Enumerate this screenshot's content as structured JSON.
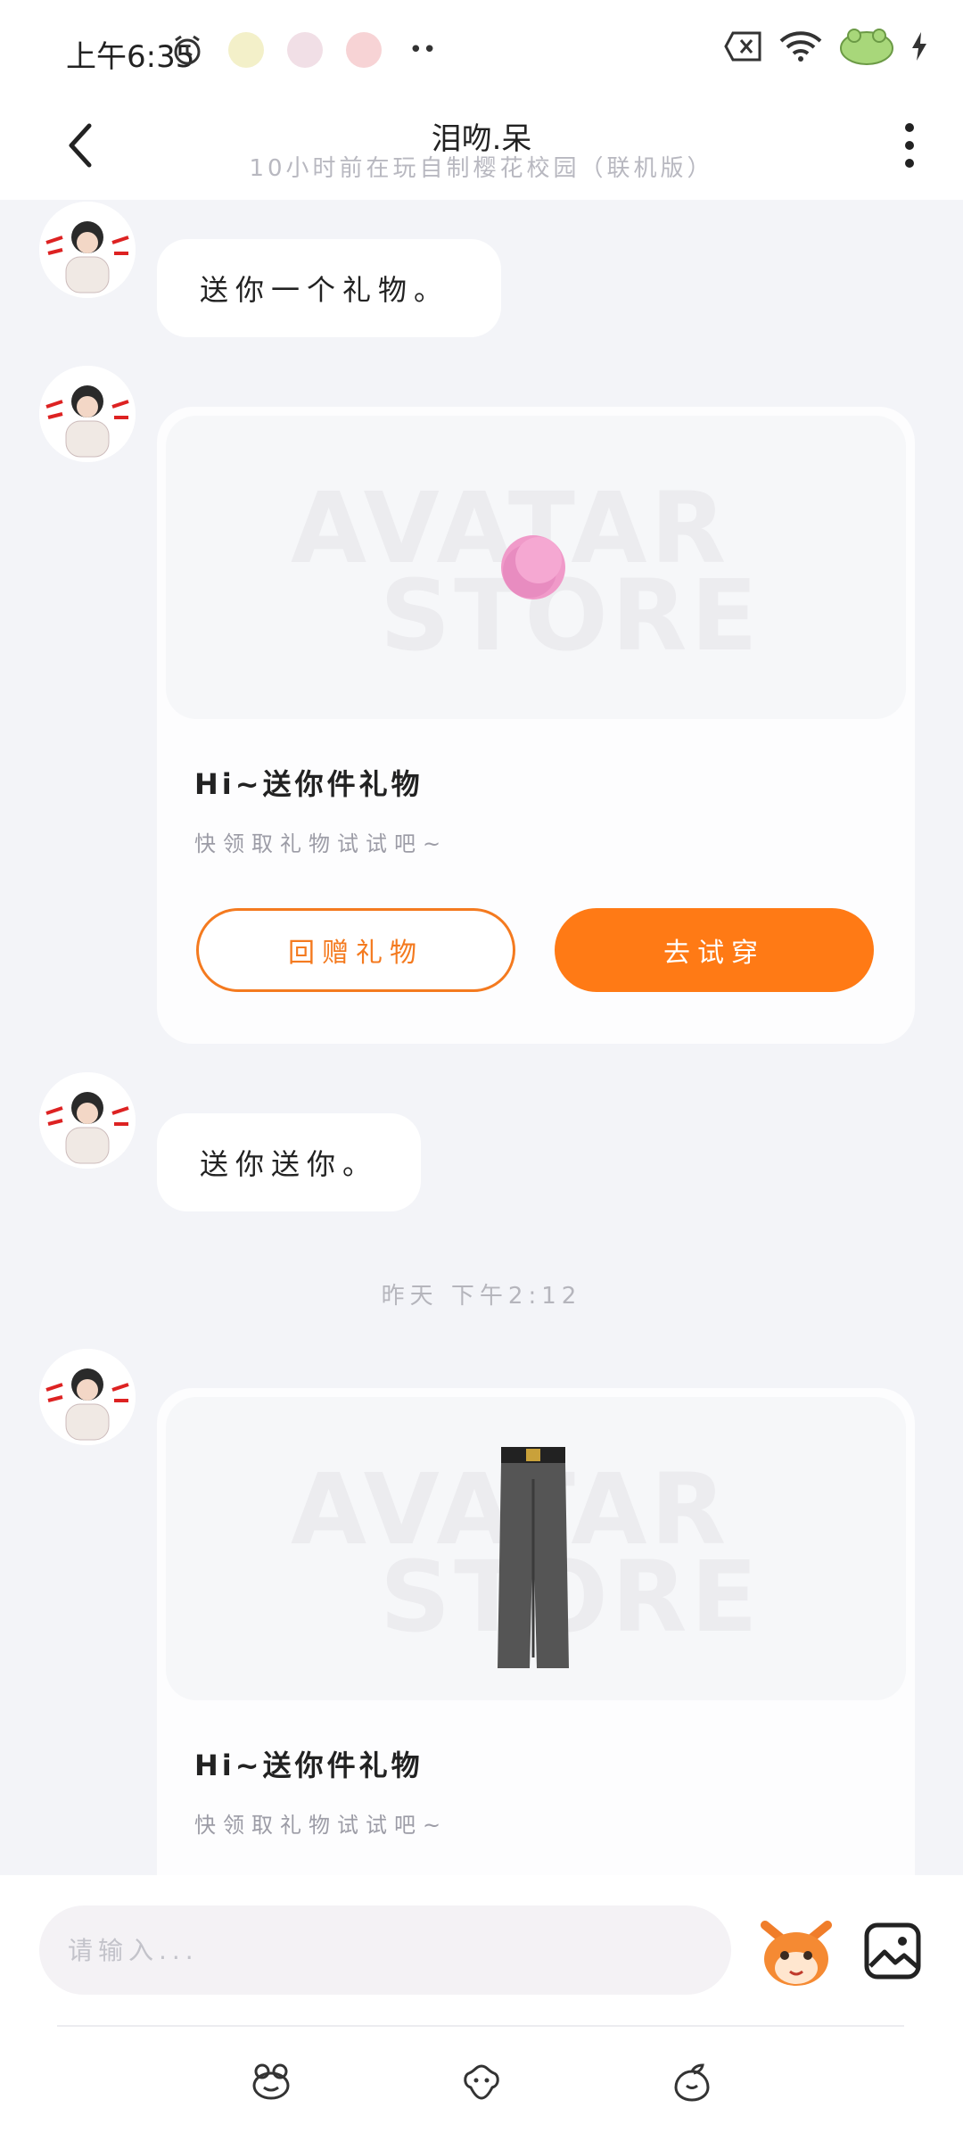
{
  "status_bar": {
    "time": "上午6:35"
  },
  "header": {
    "title": "泪吻.呆",
    "subtitle": "10小时前在玩自制樱花校园（联机版）"
  },
  "messages": {
    "msg1": "送你一个礼物。",
    "gift_card_1": {
      "title": "Hi~送你件礼物",
      "desc": "快领取礼物试试吧~",
      "watermark_top": "AVATAR",
      "watermark_bottom": "STORE",
      "return_gift_label": "回赠礼物",
      "try_on_label": "去试穿"
    },
    "msg2": "送你送你。",
    "timestamp": "昨天 下午2:12",
    "gift_card_2": {
      "title": "Hi~送你件礼物",
      "desc": "快领取礼物试试吧~",
      "watermark_top": "AVATAR",
      "watermark_bottom": "STORE"
    }
  },
  "input": {
    "placeholder": "请输入..."
  },
  "colors": {
    "accent": "#ff7a15",
    "background": "#f3f4f8"
  }
}
